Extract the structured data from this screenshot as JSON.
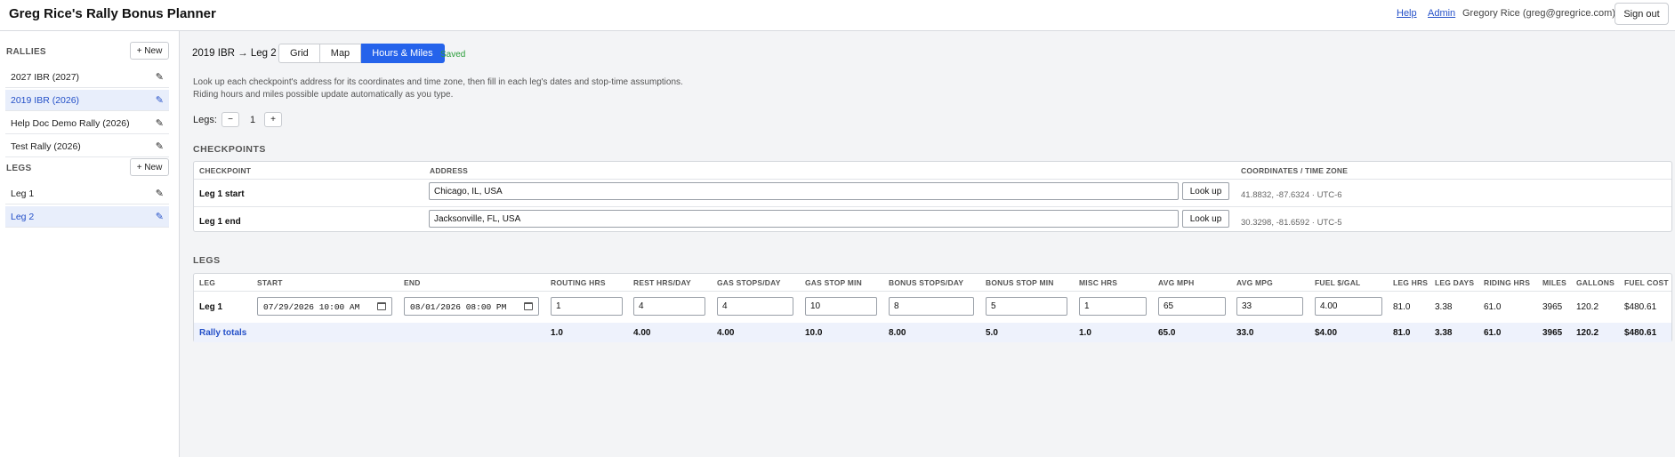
{
  "header": {
    "title": "Greg Rice's Rally Bonus Planner",
    "help": "Help",
    "admin": "Admin",
    "user": "Gregory Rice (greg@gregrice.com)",
    "signout": "Sign out"
  },
  "sidebar": {
    "rallies_title": "RALLIES",
    "rallies_new": "+ New",
    "rallies": [
      {
        "label": "2027 IBR (2027)",
        "active": false
      },
      {
        "label": "2019 IBR (2026)",
        "active": true
      },
      {
        "label": "Help Doc Demo Rally (2026)",
        "active": false
      },
      {
        "label": "Test Rally (2026)",
        "active": false
      }
    ],
    "legs_title": "LEGS",
    "legs_new": "+ New",
    "legs": [
      {
        "label": "Leg 1",
        "active": false
      },
      {
        "label": "Leg 2",
        "active": true
      }
    ],
    "edit_icon": "pencil-icon"
  },
  "main": {
    "breadcrumb": "2019 IBR → Leg 2",
    "tabs": [
      {
        "label": "Grid",
        "active": false
      },
      {
        "label": "Map",
        "active": false
      },
      {
        "label": "Hours & Miles",
        "active": true
      }
    ],
    "saved": "Saved",
    "desc_line1": "Look up each checkpoint's address for its coordinates and time zone, then fill in each leg's dates and stop-time assumptions.",
    "desc_line2": "Riding hours and miles possible update automatically as you type.",
    "legs_label": "Legs:",
    "legs_minus": "−",
    "legs_count": "1",
    "legs_plus": "+"
  },
  "checkpoints": {
    "title": "CHECKPOINTS",
    "headers": {
      "checkpoint": "CHECKPOINT",
      "address": "ADDRESS",
      "coords": "COORDINATES / TIME ZONE"
    },
    "lookup_label": "Look up",
    "rows": [
      {
        "name": "Leg 1 start",
        "address": "Chicago, IL, USA",
        "coords": "41.8832, -87.6324 · UTC-6"
      },
      {
        "name": "Leg 1 end",
        "address": "Jacksonville, FL, USA",
        "coords": "30.3298, -81.6592 · UTC-5"
      }
    ]
  },
  "legs": {
    "title": "LEGS",
    "headers": [
      "LEG",
      "START",
      "END",
      "ROUTING HRS",
      "REST HRS/DAY",
      "GAS STOPS/DAY",
      "GAS STOP MIN",
      "BONUS STOPS/DAY",
      "BONUS STOP MIN",
      "MISC HRS",
      "AVG MPH",
      "AVG MPG",
      "FUEL $/GAL",
      "LEG HRS",
      "LEG DAYS",
      "RIDING HRS",
      "MILES",
      "GALLONS",
      "FUEL COST"
    ],
    "row": {
      "leg": "Leg 1",
      "start": "07/29/2026 10:00 AM",
      "end": "08/01/2026 08:00 PM",
      "routing_hrs": "1",
      "rest_hrs_day": "4",
      "gas_stops_day": "4",
      "gas_stop_min": "10",
      "bonus_stops_day": "8",
      "bonus_stop_min": "5",
      "misc_hrs": "1",
      "avg_mph": "65",
      "avg_mpg": "33",
      "fuel_per_gal": "4.00",
      "leg_hrs": "81.0",
      "leg_days": "3.38",
      "riding_hrs": "61.0",
      "miles": "3965",
      "gallons": "120.2",
      "fuel_cost": "$480.61"
    },
    "totals": {
      "label": "Rally totals",
      "routing_hrs": "1.0",
      "rest_hrs_day": "4.00",
      "gas_stops_day": "4.00",
      "gas_stop_min": "10.0",
      "bonus_stops_day": "8.00",
      "bonus_stop_min": "5.0",
      "misc_hrs": "1.0",
      "avg_mph": "65.0",
      "avg_mpg": "33.0",
      "fuel_per_gal": "$4.00",
      "leg_hrs": "81.0",
      "leg_days": "3.38",
      "riding_hrs": "61.0",
      "miles": "3965",
      "gallons": "120.2",
      "fuel_cost": "$480.61"
    }
  },
  "colors": {
    "accent": "#2563eb",
    "link": "#2450c8",
    "saved": "#2a9d3a",
    "active_row": "#e8eefb"
  }
}
